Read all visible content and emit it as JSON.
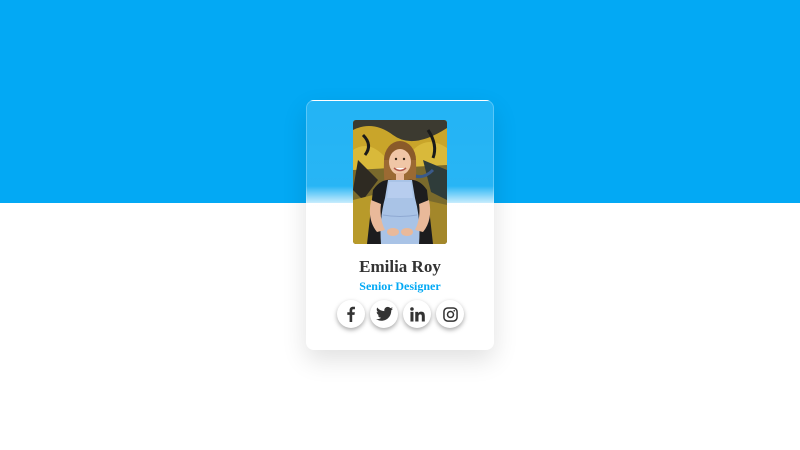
{
  "profile": {
    "name": "Emilia Roy",
    "role": "Senior Designer"
  },
  "socials": [
    {
      "icon": "facebook-icon"
    },
    {
      "icon": "twitter-icon"
    },
    {
      "icon": "linkedin-icon"
    },
    {
      "icon": "instagram-icon"
    }
  ],
  "colors": {
    "accent": "#03a9f4",
    "name_text": "#333333",
    "icon": "#333333",
    "page_bottom": "#ffffff"
  }
}
